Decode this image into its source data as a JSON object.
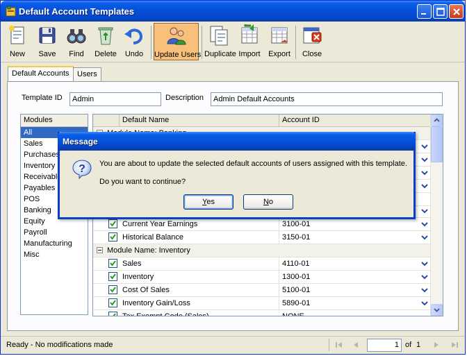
{
  "window": {
    "title": "Default Account Templates"
  },
  "toolbar": {
    "items": [
      {
        "label": "New",
        "icon": "new-document-icon"
      },
      {
        "label": "Save",
        "icon": "floppy-disk-icon"
      },
      {
        "label": "Find",
        "icon": "binoculars-icon"
      },
      {
        "label": "Delete",
        "icon": "recycle-bin-icon"
      },
      {
        "label": "Undo",
        "icon": "undo-arrow-icon"
      },
      {
        "label": "Update Users",
        "icon": "users-icon"
      },
      {
        "label": "Duplicate",
        "icon": "duplicate-icon"
      },
      {
        "label": "Import",
        "icon": "import-icon"
      },
      {
        "label": "Export",
        "icon": "export-icon"
      },
      {
        "label": "Close",
        "icon": "close-window-icon"
      }
    ]
  },
  "tabs": [
    {
      "label": "Default Accounts"
    },
    {
      "label": "Users"
    }
  ],
  "form": {
    "template_id_label": "Template ID",
    "template_id_value": "Admin",
    "description_label": "Description",
    "description_value": "Admin Default Accounts"
  },
  "modules": {
    "header": "Modules",
    "items": [
      "All",
      "Sales",
      "Purchases",
      "Inventory",
      "Receivables",
      "Payables",
      "POS",
      "Banking",
      "Equity",
      "Payroll",
      "Manufacturing",
      "Misc"
    ]
  },
  "grid": {
    "columns": {
      "name": "Default Name",
      "account": "Account ID"
    },
    "top_group": "Module Name: Banking",
    "rows_equity": [
      {
        "name": "Current Year Earnings",
        "account": "3100-01"
      },
      {
        "name": "Historical Balance",
        "account": "3150-01"
      }
    ],
    "group_inventory": "Module Name: Inventory",
    "rows_inventory": [
      {
        "name": "Sales",
        "account": "4110-01"
      },
      {
        "name": "Inventory",
        "account": "1300-01"
      },
      {
        "name": "Cost Of Sales",
        "account": "5100-01"
      },
      {
        "name": "Inventory Gain/Loss",
        "account": "5890-01"
      },
      {
        "name": "Tax Exempt Code (Sales)",
        "account": "NONE"
      }
    ]
  },
  "status": {
    "text": "Ready - No modifications made",
    "page": "1",
    "of_label": "of",
    "total_pages": "1"
  },
  "dialog": {
    "title": "Message",
    "icon": "question-icon",
    "message": "You are about to update the selected default accounts of users assigned with this template.",
    "question": "Do you want to continue?",
    "yes_rest": "es",
    "yes_key": "Y",
    "no_rest": "o",
    "no_key": "N"
  }
}
